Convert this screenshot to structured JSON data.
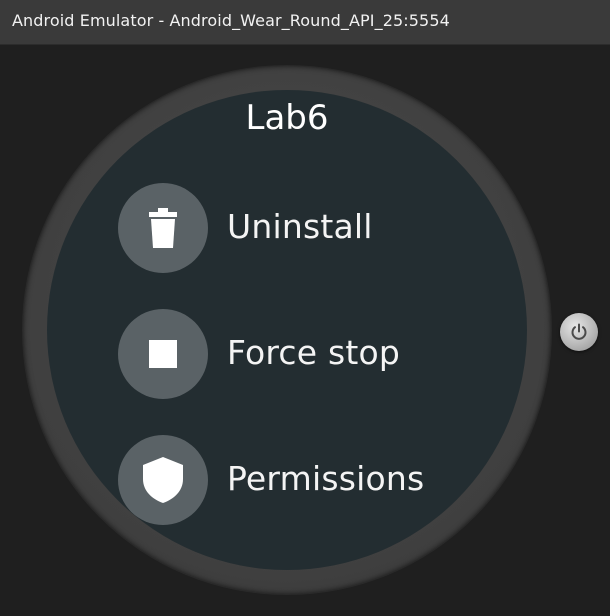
{
  "window": {
    "title": "Android Emulator - Android_Wear_Round_API_25:5554"
  },
  "app": {
    "title": "Lab6"
  },
  "menu": {
    "items": [
      {
        "label": "Uninstall",
        "icon": "trash-icon"
      },
      {
        "label": "Force stop",
        "icon": "stop-icon"
      },
      {
        "label": "Permissions",
        "icon": "shield-icon"
      }
    ]
  },
  "controls": {
    "power_icon": "power-icon"
  },
  "colors": {
    "titlebar": "#3a3a3a",
    "background": "#1f1f1f",
    "screen": "#232d31",
    "icon_circle": "#5a6266",
    "text": "#ffffff"
  }
}
